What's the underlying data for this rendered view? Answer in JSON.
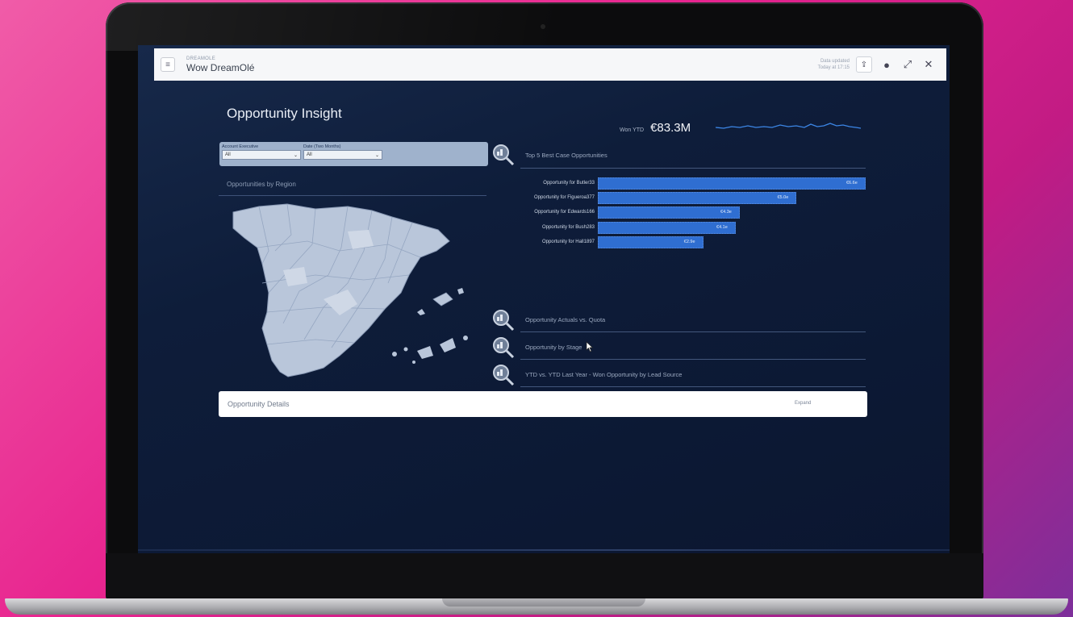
{
  "app": {
    "subtitle": "DREAMOLE",
    "title": "Wow DreamOlé",
    "data_updated_line1": "Data updated",
    "data_updated_line2": "Today at 17:15"
  },
  "dashboard": {
    "title": "Opportunity Insight",
    "won_ytd_label": "Won YTD",
    "won_ytd_value": "€83.3M"
  },
  "filters": [
    {
      "label": "Account Executive",
      "value": "All"
    },
    {
      "label": "Date (Two Months)",
      "value": "All"
    }
  ],
  "region": {
    "title": "Opportunities by Region"
  },
  "top5": {
    "title": "Top 5 Best Case Opportunities"
  },
  "chart_data": {
    "type": "bar",
    "title": "Top 5 Best Case Opportunities",
    "orientation": "horizontal",
    "categories": [
      "Opportunity for Butler33",
      "Opportunity for Figueroa377",
      "Opportunity for Edwards166",
      "Opportunity for Bush283",
      "Opportunity for Hall1897"
    ],
    "values": [
      6.6,
      4.9,
      3.5,
      3.4,
      2.6
    ],
    "value_labels": [
      "€6.6e",
      "€5.0e",
      "€4.3e",
      "€4.1e",
      "€2.9e"
    ],
    "xlim": [
      0,
      6.6
    ],
    "color": "#2f6ed1"
  },
  "sections": [
    {
      "title": "Opportunity Actuals vs. Quota"
    },
    {
      "title": "Opportunity by Stage"
    },
    {
      "title": "YTD vs. YTD Last Year - Won Opportunity by Lead Source"
    }
  ],
  "details": {
    "title": "Opportunity Details",
    "expand_label": "Expand"
  },
  "colors": {
    "screen_bg": "#0e1d3a",
    "bar": "#2f6ed1",
    "map_fill": "#b9c6da",
    "filter_panel": "#9fb2cc"
  }
}
